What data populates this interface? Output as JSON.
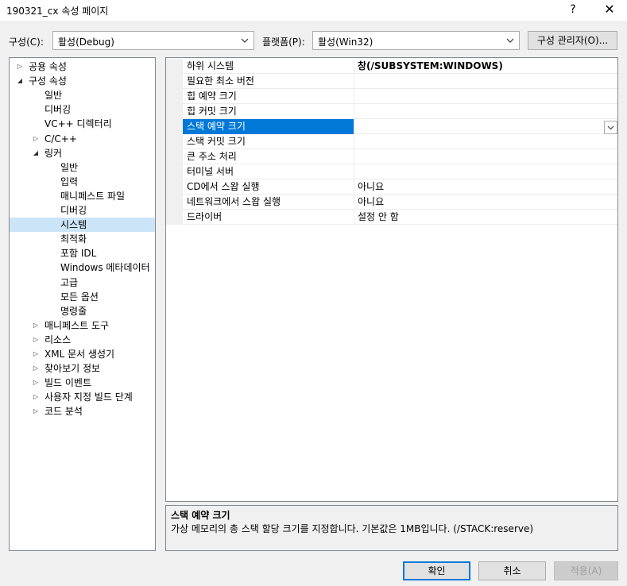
{
  "window": {
    "title": "190321_cx 속성 페이지",
    "help": "?",
    "close": "✕"
  },
  "toolbar": {
    "config_label": "구성(C):",
    "config_value": "활성(Debug)",
    "platform_label": "플랫폼(P):",
    "platform_value": "활성(Win32)",
    "config_manager_label": "구성 관리자(O)..."
  },
  "tree": {
    "items": [
      {
        "label": "공용 속성",
        "expander": "▷"
      },
      {
        "label": "구성 속성",
        "expander": "◢"
      },
      {
        "label": "일반",
        "expander": ""
      },
      {
        "label": "디버깅",
        "expander": ""
      },
      {
        "label": "VC++ 디렉터리",
        "expander": ""
      },
      {
        "label": "C/C++",
        "expander": "▷"
      },
      {
        "label": "링커",
        "expander": "◢"
      },
      {
        "label": "일반",
        "expander": ""
      },
      {
        "label": "입력",
        "expander": ""
      },
      {
        "label": "매니페스트 파일",
        "expander": ""
      },
      {
        "label": "디버깅",
        "expander": ""
      },
      {
        "label": "시스템",
        "expander": ""
      },
      {
        "label": "최적화",
        "expander": ""
      },
      {
        "label": "포함 IDL",
        "expander": ""
      },
      {
        "label": "Windows 메타데이터",
        "expander": ""
      },
      {
        "label": "고급",
        "expander": ""
      },
      {
        "label": "모든 옵션",
        "expander": ""
      },
      {
        "label": "명령줄",
        "expander": ""
      },
      {
        "label": "매니페스트 도구",
        "expander": "▷"
      },
      {
        "label": "리소스",
        "expander": "▷"
      },
      {
        "label": "XML 문서 생성기",
        "expander": "▷"
      },
      {
        "label": "찾아보기 정보",
        "expander": "▷"
      },
      {
        "label": "빌드 이벤트",
        "expander": "▷"
      },
      {
        "label": "사용자 지정 빌드 단계",
        "expander": "▷"
      },
      {
        "label": "코드 분석",
        "expander": "▷"
      }
    ]
  },
  "properties": {
    "rows": [
      {
        "name": "하위 시스템",
        "value": "창(/SUBSYSTEM:WINDOWS)"
      },
      {
        "name": "필요한 최소 버전",
        "value": ""
      },
      {
        "name": "힙 예약 크기",
        "value": ""
      },
      {
        "name": "힙 커밋 크기",
        "value": ""
      },
      {
        "name": "스택 예약 크기",
        "value": ""
      },
      {
        "name": "스택 커밋 크기",
        "value": ""
      },
      {
        "name": "큰 주소 처리",
        "value": ""
      },
      {
        "name": "터미널 서버",
        "value": ""
      },
      {
        "name": "CD에서 스왑 실행",
        "value": "아니요"
      },
      {
        "name": "네트워크에서 스왑 실행",
        "value": "아니요"
      },
      {
        "name": "드라이버",
        "value": "설정 안 함"
      }
    ]
  },
  "description": {
    "title": "스택 예약 크기",
    "text": "가상 메모리의 총 스택 할당 크기를 지정합니다. 기본값은 1MB입니다.     (/STACK:reserve)"
  },
  "buttons": {
    "ok": "확인",
    "cancel": "취소",
    "apply": "적용(A)"
  },
  "colors": {
    "selection": "#0078d7",
    "tree_selection": "#cce4f7"
  }
}
